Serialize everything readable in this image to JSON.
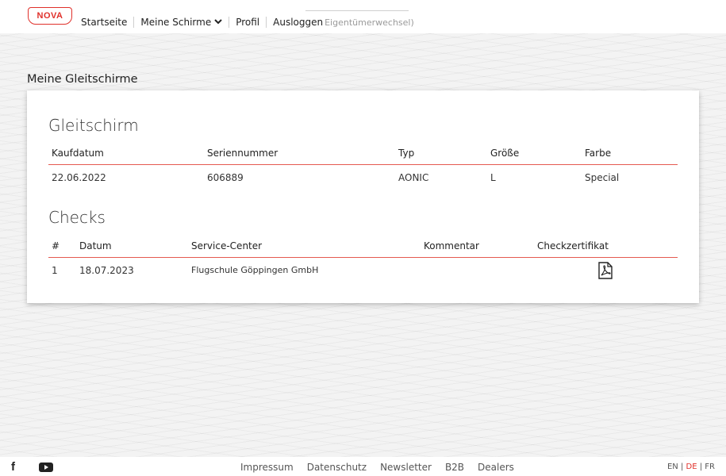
{
  "header": {
    "logo_text": "NOVA",
    "nav": [
      {
        "label": "Startseite"
      },
      {
        "label": "Meine Schirme"
      },
      {
        "label": "Profil"
      },
      {
        "label": "Ausloggen"
      }
    ],
    "faded_text": "Eigentümerwechsel)"
  },
  "page_title": "Meine Gleitschirme",
  "glider": {
    "title": "Gleitschirm",
    "columns": [
      "Kaufdatum",
      "Seriennummer",
      "Typ",
      "Größe",
      "Farbe"
    ],
    "row": [
      "22.06.2022",
      "606889",
      "AONIC",
      "L",
      "Special"
    ]
  },
  "checks": {
    "title": "Checks",
    "columns": [
      "#",
      "Datum",
      "Service-Center",
      "Kommentar",
      "Checkzertifikat"
    ],
    "rows": [
      {
        "num": "1",
        "date": "18.07.2023",
        "center": "Flugschule Göppingen GmbH",
        "comment": "",
        "certificate_icon": "pdf-icon"
      }
    ]
  },
  "footer": {
    "social": [
      "facebook-icon",
      "youtube-icon"
    ],
    "links": [
      "Impressum",
      "Datenschutz",
      "Newsletter",
      "B2B",
      "Dealers"
    ],
    "languages": [
      "EN",
      "DE",
      "FR"
    ],
    "active_language": "DE"
  },
  "colors": {
    "accent": "#e0302a",
    "table_rule": "#e55a50"
  }
}
